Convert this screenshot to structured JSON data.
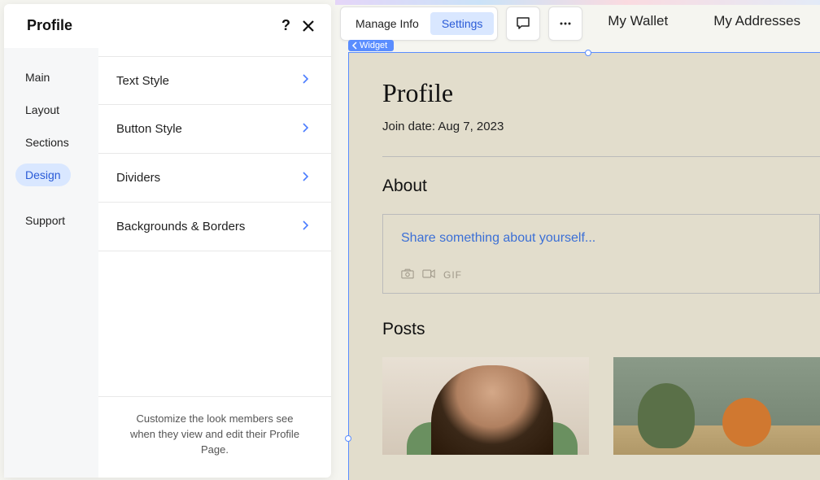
{
  "panel": {
    "title": "Profile",
    "help_icon": "?",
    "sidebar": {
      "items": [
        {
          "label": "Main"
        },
        {
          "label": "Layout"
        },
        {
          "label": "Sections"
        },
        {
          "label": "Design"
        },
        {
          "label": "Support"
        }
      ]
    },
    "options": [
      {
        "label": "Text Style"
      },
      {
        "label": "Button Style"
      },
      {
        "label": "Dividers"
      },
      {
        "label": "Backgrounds & Borders"
      }
    ],
    "footer_tip": "Customize the look members see when they view and edit their Profile Page."
  },
  "toolbar": {
    "manage_info": "Manage Info",
    "settings": "Settings"
  },
  "nav": {
    "wallet": "My Wallet",
    "addresses": "My Addresses"
  },
  "widget_tag": "Widget",
  "profile": {
    "heading": "Profile",
    "join_date": "Join date: Aug 7, 2023",
    "about_heading": "About",
    "about_placeholder": "Share something about yourself...",
    "gif_label": "GIF",
    "posts_heading": "Posts"
  }
}
